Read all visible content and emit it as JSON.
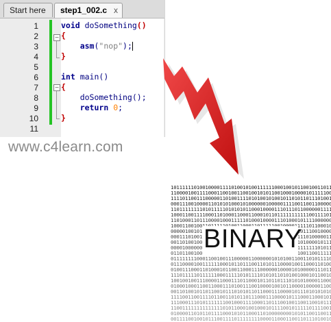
{
  "editor": {
    "tabs": [
      {
        "label": "Start here"
      },
      {
        "label": "step1_002.c",
        "close": "x"
      }
    ],
    "line_numbers": [
      "1",
      "2",
      "3",
      "4",
      "5",
      "6",
      "7",
      "8",
      "9",
      "10",
      "11"
    ],
    "lines": [
      "void doSomething()",
      "{",
      "    asm(\"nop\");",
      "}",
      "",
      "int main()",
      "{",
      "    doSomething();",
      "    return 0;",
      "}",
      ""
    ]
  },
  "watermark": "www.c4learn.com",
  "binary_image": {
    "word": "BINARY"
  },
  "colors": {
    "arrow": "#e02020",
    "change_bar": "#25c425"
  }
}
